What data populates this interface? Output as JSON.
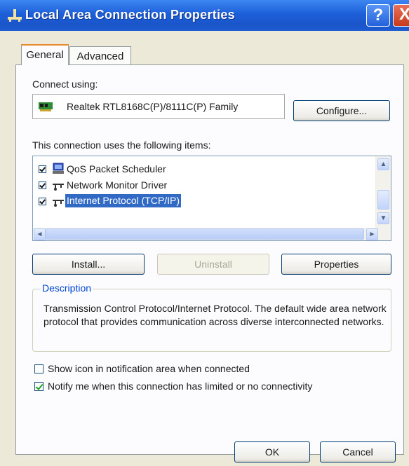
{
  "window": {
    "title": "Local Area Connection Properties",
    "help_label": "?",
    "close_label": "X",
    "icon": "network-connection-icon"
  },
  "tabs": [
    {
      "label": "General",
      "selected": true
    },
    {
      "label": "Advanced",
      "selected": false
    }
  ],
  "connect_using": {
    "label": "Connect using:",
    "adapter": "Realtek RTL8168C(P)/8111C(P) Family",
    "adapter_icon": "network-adapter-icon",
    "configure_label": "Configure..."
  },
  "items_section": {
    "label": "This connection uses the following items:",
    "items": [
      {
        "label": "QoS Packet Scheduler",
        "checked": true,
        "selected": false,
        "icon": "qos-scheduler-icon"
      },
      {
        "label": "Network Monitor Driver",
        "checked": true,
        "selected": false,
        "icon": "network-protocol-icon"
      },
      {
        "label": "Internet Protocol (TCP/IP)",
        "checked": true,
        "selected": true,
        "icon": "network-protocol-icon"
      }
    ],
    "scroll_up": "▲",
    "scroll_down": "▼",
    "scroll_left": "◄",
    "scroll_right": "►"
  },
  "buttons": {
    "install": "Install...",
    "uninstall": "Uninstall",
    "properties": "Properties",
    "ok": "OK",
    "cancel": "Cancel"
  },
  "description": {
    "legend": "Description",
    "text": "Transmission Control Protocol/Internet Protocol. The default wide area network protocol that provides communication across diverse interconnected networks."
  },
  "options": {
    "show_icon": {
      "label": "Show icon in notification area when connected",
      "checked": false
    },
    "notify": {
      "label": "Notify me when this connection has limited or no connectivity",
      "checked": true
    }
  },
  "colors": {
    "titlebar": "#1d5fd9",
    "selection": "#316ac5",
    "legend": "#0046d5",
    "dialog_bg": "#ece9d8"
  }
}
